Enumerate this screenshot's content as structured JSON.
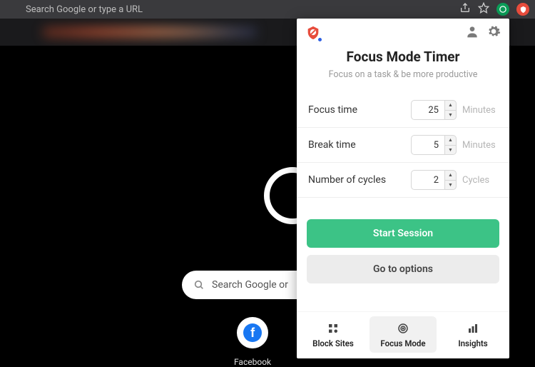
{
  "browser": {
    "url_placeholder": "Search Google or type a URL"
  },
  "underlying": {
    "search_placeholder": "Search Google or",
    "shortcut_label": "Facebook"
  },
  "popup": {
    "title": "Focus Mode Timer",
    "subtitle": "Focus on a task & be more productive",
    "rows": {
      "focus": {
        "label": "Focus time",
        "value": "25",
        "unit": "Minutes"
      },
      "break": {
        "label": "Break time",
        "value": "5",
        "unit": "Minutes"
      },
      "cycles": {
        "label": "Number of cycles",
        "value": "2",
        "unit": "Cycles"
      }
    },
    "start_label": "Start Session",
    "options_label": "Go to options",
    "tabs": {
      "block": "Block Sites",
      "focus": "Focus Mode",
      "insights": "Insights"
    }
  }
}
